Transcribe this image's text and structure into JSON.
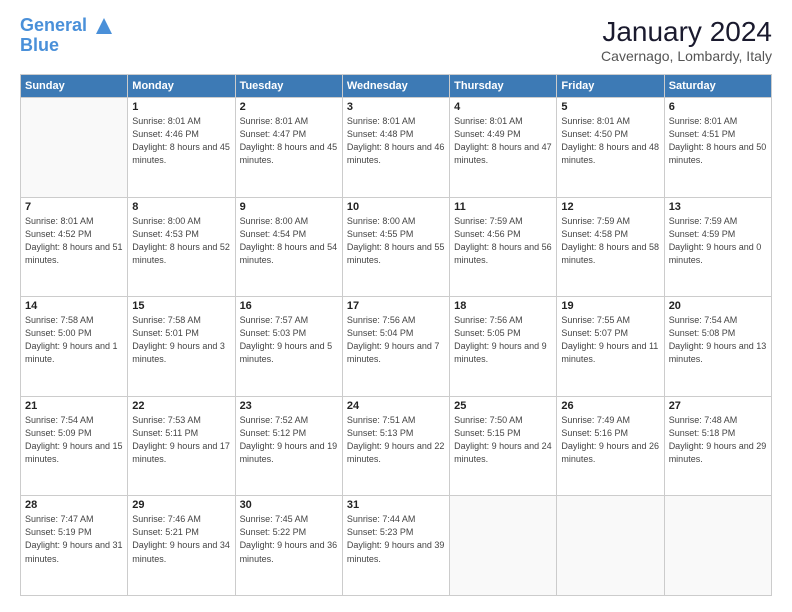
{
  "header": {
    "logo_line1": "General",
    "logo_line2": "Blue",
    "month": "January 2024",
    "location": "Cavernago, Lombardy, Italy"
  },
  "days_of_week": [
    "Sunday",
    "Monday",
    "Tuesday",
    "Wednesday",
    "Thursday",
    "Friday",
    "Saturday"
  ],
  "weeks": [
    [
      {
        "num": "",
        "empty": true
      },
      {
        "num": "1",
        "sunrise": "8:01 AM",
        "sunset": "4:46 PM",
        "daylight": "8 hours and 45 minutes."
      },
      {
        "num": "2",
        "sunrise": "8:01 AM",
        "sunset": "4:47 PM",
        "daylight": "8 hours and 45 minutes."
      },
      {
        "num": "3",
        "sunrise": "8:01 AM",
        "sunset": "4:48 PM",
        "daylight": "8 hours and 46 minutes."
      },
      {
        "num": "4",
        "sunrise": "8:01 AM",
        "sunset": "4:49 PM",
        "daylight": "8 hours and 47 minutes."
      },
      {
        "num": "5",
        "sunrise": "8:01 AM",
        "sunset": "4:50 PM",
        "daylight": "8 hours and 48 minutes."
      },
      {
        "num": "6",
        "sunrise": "8:01 AM",
        "sunset": "4:51 PM",
        "daylight": "8 hours and 50 minutes."
      }
    ],
    [
      {
        "num": "7",
        "sunrise": "8:01 AM",
        "sunset": "4:52 PM",
        "daylight": "8 hours and 51 minutes."
      },
      {
        "num": "8",
        "sunrise": "8:00 AM",
        "sunset": "4:53 PM",
        "daylight": "8 hours and 52 minutes."
      },
      {
        "num": "9",
        "sunrise": "8:00 AM",
        "sunset": "4:54 PM",
        "daylight": "8 hours and 54 minutes."
      },
      {
        "num": "10",
        "sunrise": "8:00 AM",
        "sunset": "4:55 PM",
        "daylight": "8 hours and 55 minutes."
      },
      {
        "num": "11",
        "sunrise": "7:59 AM",
        "sunset": "4:56 PM",
        "daylight": "8 hours and 56 minutes."
      },
      {
        "num": "12",
        "sunrise": "7:59 AM",
        "sunset": "4:58 PM",
        "daylight": "8 hours and 58 minutes."
      },
      {
        "num": "13",
        "sunrise": "7:59 AM",
        "sunset": "4:59 PM",
        "daylight": "9 hours and 0 minutes."
      }
    ],
    [
      {
        "num": "14",
        "sunrise": "7:58 AM",
        "sunset": "5:00 PM",
        "daylight": "9 hours and 1 minute."
      },
      {
        "num": "15",
        "sunrise": "7:58 AM",
        "sunset": "5:01 PM",
        "daylight": "9 hours and 3 minutes."
      },
      {
        "num": "16",
        "sunrise": "7:57 AM",
        "sunset": "5:03 PM",
        "daylight": "9 hours and 5 minutes."
      },
      {
        "num": "17",
        "sunrise": "7:56 AM",
        "sunset": "5:04 PM",
        "daylight": "9 hours and 7 minutes."
      },
      {
        "num": "18",
        "sunrise": "7:56 AM",
        "sunset": "5:05 PM",
        "daylight": "9 hours and 9 minutes."
      },
      {
        "num": "19",
        "sunrise": "7:55 AM",
        "sunset": "5:07 PM",
        "daylight": "9 hours and 11 minutes."
      },
      {
        "num": "20",
        "sunrise": "7:54 AM",
        "sunset": "5:08 PM",
        "daylight": "9 hours and 13 minutes."
      }
    ],
    [
      {
        "num": "21",
        "sunrise": "7:54 AM",
        "sunset": "5:09 PM",
        "daylight": "9 hours and 15 minutes."
      },
      {
        "num": "22",
        "sunrise": "7:53 AM",
        "sunset": "5:11 PM",
        "daylight": "9 hours and 17 minutes."
      },
      {
        "num": "23",
        "sunrise": "7:52 AM",
        "sunset": "5:12 PM",
        "daylight": "9 hours and 19 minutes."
      },
      {
        "num": "24",
        "sunrise": "7:51 AM",
        "sunset": "5:13 PM",
        "daylight": "9 hours and 22 minutes."
      },
      {
        "num": "25",
        "sunrise": "7:50 AM",
        "sunset": "5:15 PM",
        "daylight": "9 hours and 24 minutes."
      },
      {
        "num": "26",
        "sunrise": "7:49 AM",
        "sunset": "5:16 PM",
        "daylight": "9 hours and 26 minutes."
      },
      {
        "num": "27",
        "sunrise": "7:48 AM",
        "sunset": "5:18 PM",
        "daylight": "9 hours and 29 minutes."
      }
    ],
    [
      {
        "num": "28",
        "sunrise": "7:47 AM",
        "sunset": "5:19 PM",
        "daylight": "9 hours and 31 minutes."
      },
      {
        "num": "29",
        "sunrise": "7:46 AM",
        "sunset": "5:21 PM",
        "daylight": "9 hours and 34 minutes."
      },
      {
        "num": "30",
        "sunrise": "7:45 AM",
        "sunset": "5:22 PM",
        "daylight": "9 hours and 36 minutes."
      },
      {
        "num": "31",
        "sunrise": "7:44 AM",
        "sunset": "5:23 PM",
        "daylight": "9 hours and 39 minutes."
      },
      {
        "num": "",
        "empty": true
      },
      {
        "num": "",
        "empty": true
      },
      {
        "num": "",
        "empty": true
      }
    ]
  ]
}
